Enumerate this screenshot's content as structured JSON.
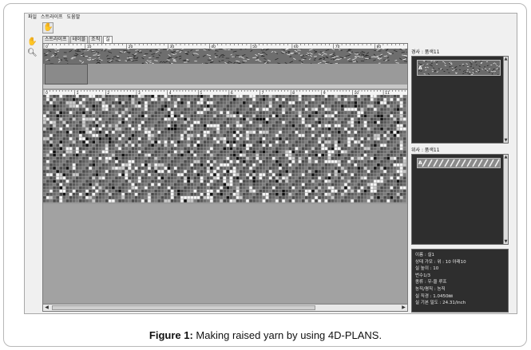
{
  "menu": [
    "파일",
    "스트라이프",
    "도움말"
  ],
  "toolbar": {
    "hand_icon": "hand-icon"
  },
  "side_tools": [
    "hand-icon",
    "magnifier-icon"
  ],
  "tabs": [
    {
      "label": "스트라이프",
      "active": false
    },
    {
      "label": "테이블",
      "active": false
    },
    {
      "label": "조직",
      "active": false
    },
    {
      "label": "실",
      "active": true
    }
  ],
  "top_ruler": [
    "0",
    "10",
    "20",
    "30",
    "40",
    "50",
    "60",
    "70",
    "80"
  ],
  "grid_ruler": [
    "0",
    "1",
    "2",
    "3",
    "4",
    "5",
    "6",
    "7",
    "8",
    "9",
    "10",
    "11"
  ],
  "warp_panel": {
    "label": "경사 : 품색11",
    "thumb_letter": "A"
  },
  "weft_panel": {
    "label": "위사 : 품색11",
    "thumb_letter": "A"
  },
  "info": {
    "lines": [
      "이름 : 실1",
      "상태 가모 : 위 : 10 아래10",
      "실 높이 : 10",
      "번수1/3",
      "종류 : 우-울     루프",
      "농직/평직 : 농직",
      "실 직경 : 1.0450㎜",
      "실 기본 밀도 : 24.31/inch"
    ]
  },
  "caption": {
    "label": "Figure 1:",
    "text": " Making raised yarn by using 4D-PLANS."
  }
}
